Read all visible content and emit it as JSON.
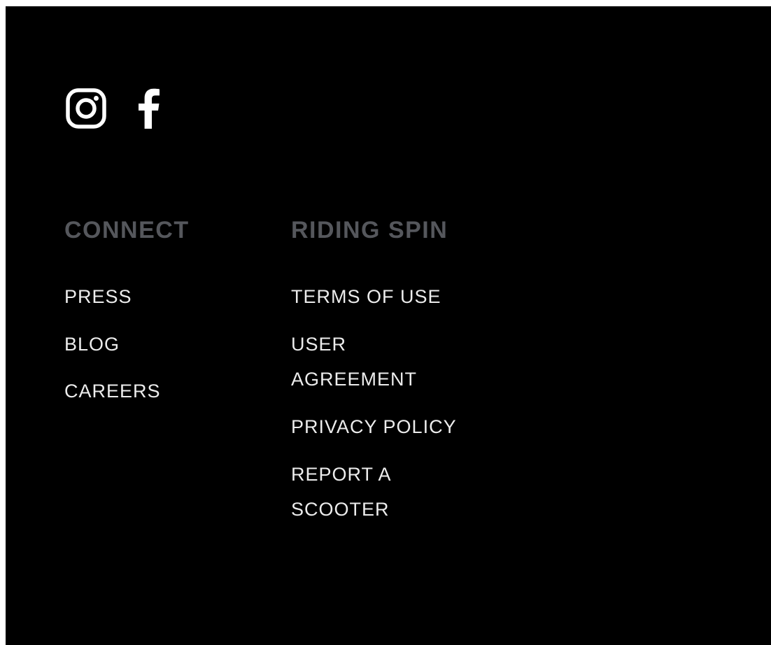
{
  "social": {
    "instagram_icon": "instagram-icon",
    "facebook_icon": "facebook-icon",
    "icon_color": "#ffffff"
  },
  "connect": {
    "heading": "CONNECT",
    "links": [
      "PRESS",
      "BLOG",
      "CAREERS"
    ]
  },
  "riding_spin": {
    "heading": "RIDING SPIN",
    "links": [
      "TERMS OF USE",
      "USER AGREEMENT",
      "PRIVACY POLICY",
      "REPORT A SCOOTER"
    ]
  },
  "colors": {
    "background": "#000000",
    "heading": "#55575c",
    "link": "#ececec"
  }
}
